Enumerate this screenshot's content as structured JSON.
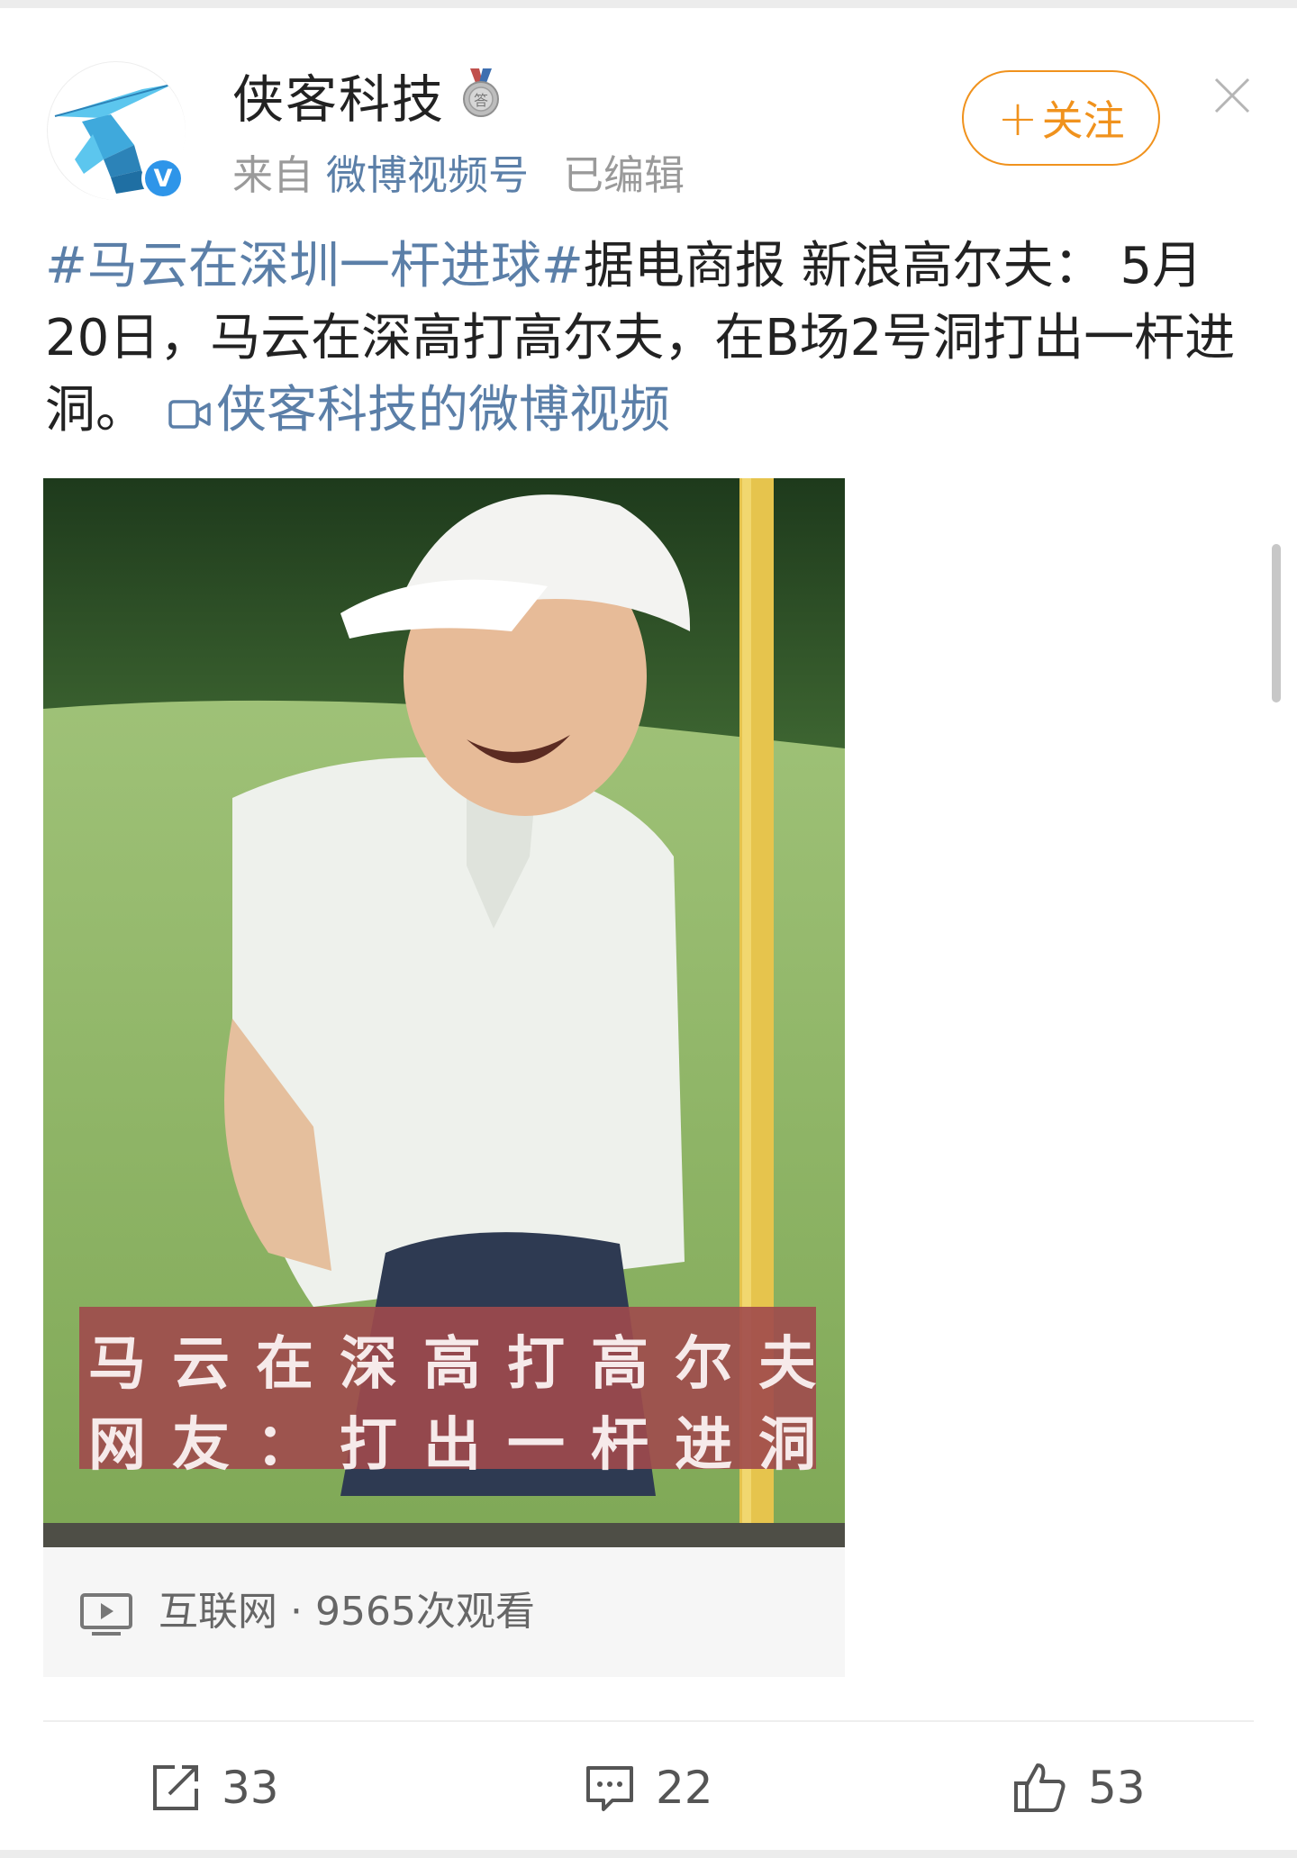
{
  "post": {
    "author": "侠客科技",
    "source_prefix": "来自",
    "source": "微博视频号",
    "edited": "已编辑",
    "follow_label": "关注",
    "text": {
      "topic": "#马云在深圳一杆进球#",
      "body": "据电商报 新浪高尔夫： 5月20日，马云在深高打高尔夫，在B场2号洞打出一杆进洞。",
      "video_link": "侠客科技的微博视频"
    }
  },
  "video": {
    "caption_line1": "马云在深高打高尔夫",
    "caption_line2": "网友：打出一杆进洞",
    "source_label": "互联网",
    "separator": "·",
    "views": "9565次观看"
  },
  "actions": {
    "repost_count": "33",
    "comment_count": "22",
    "like_count": "53"
  },
  "colors": {
    "link": "#5b7fa8",
    "follow": "#f0921d",
    "verified": "#2e95e9"
  },
  "icons": {
    "medal": "medal-icon",
    "verified": "verified-v-icon",
    "close": "close-icon",
    "video_link": "video-camera-icon",
    "play": "play-screen-icon",
    "repost": "repost-icon",
    "comment": "comment-icon",
    "like": "thumbs-up-icon"
  }
}
